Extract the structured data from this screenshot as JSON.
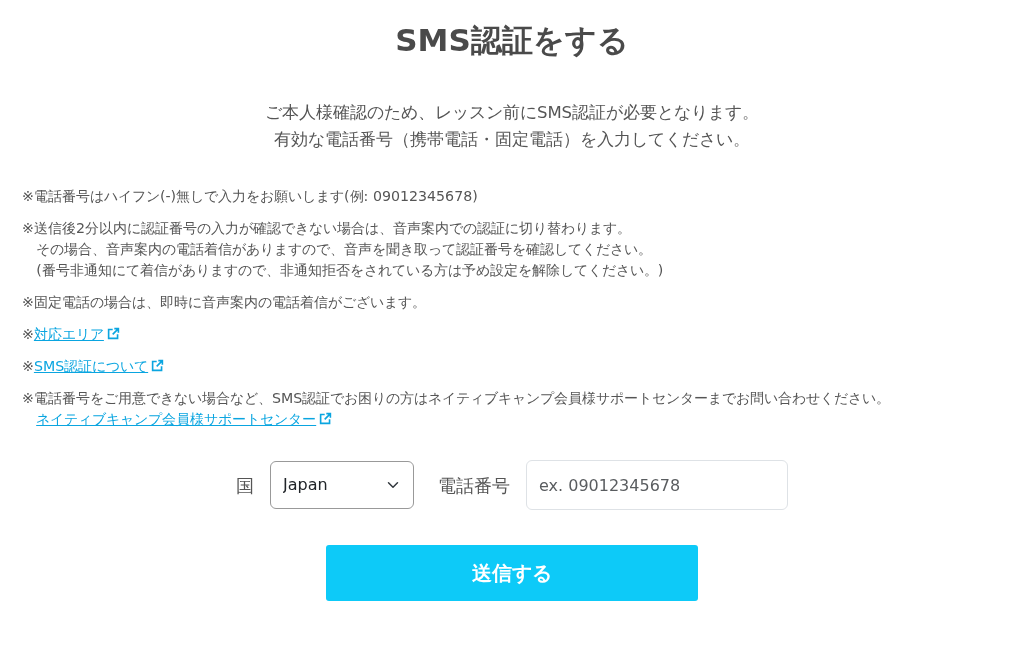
{
  "title": "SMS認証をする",
  "intro": [
    "ご本人様確認のため、レッスン前にSMS認証が必要となります。",
    "有効な電話番号（携帯電話・固定電話）を入力してください。"
  ],
  "notes": [
    {
      "kind": "text",
      "lines": [
        "※電話番号はハイフン(-)無しで入力をお願いします(例: 09012345678)"
      ]
    },
    {
      "kind": "text",
      "lines": [
        "※送信後2分以内に認証番号の入力が確認できない場合は、音声案内での認証に切り替わります。",
        "その場合、音声案内の電話着信がありますので、音声を聞き取って認証番号を確認してください。",
        "(番号非通知にて着信がありますので、非通知拒否をされている方は予め設定を解除してください。)"
      ]
    },
    {
      "kind": "text",
      "lines": [
        "※固定電話の場合は、即時に音声案内の電話着信がございます。"
      ]
    },
    {
      "kind": "link",
      "mark": "※",
      "link": "対応エリア"
    },
    {
      "kind": "link",
      "mark": "※",
      "link": "SMS認証について"
    },
    {
      "kind": "text_link",
      "lines": [
        "※電話番号をご用意できない場合など、SMS認証でお困りの方はネイティブキャンプ会員様サポートセンターまでお問い合わせください。"
      ],
      "link": "ネイティブキャンプ会員様サポートセンター"
    }
  ],
  "form": {
    "country_label": "国",
    "country_value": "Japan",
    "phone_label": "電話番号",
    "phone_placeholder": "ex. 09012345678"
  },
  "submit": "送信する"
}
